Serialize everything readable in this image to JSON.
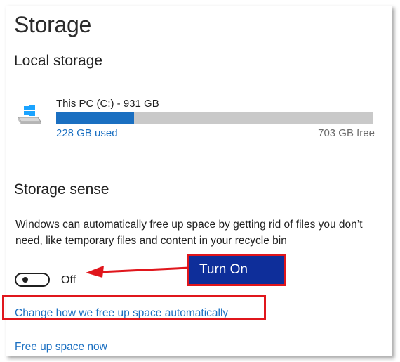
{
  "page": {
    "title": "Storage"
  },
  "local_storage": {
    "heading": "Local storage",
    "drive": {
      "icon": "windows-drive-icon",
      "name": "This PC (C:) - 931 GB",
      "used_label": "228 GB used",
      "free_label": "703 GB free",
      "used_fraction": 0.245
    }
  },
  "storage_sense": {
    "heading": "Storage sense",
    "description": "Windows can automatically free up space by getting rid of files you don’t need, like temporary files and content in your recycle bin",
    "toggle_state": "Off",
    "toggle_on": false,
    "callout_label": "Turn On",
    "change_link": "Change how we free up space automatically",
    "free_now_link": "Free up space now"
  },
  "colors": {
    "accent": "#1a6fc1",
    "bar_track": "#c9c9c9",
    "annotation_red": "#e0161c",
    "callout_blue": "#0e2e9a"
  }
}
